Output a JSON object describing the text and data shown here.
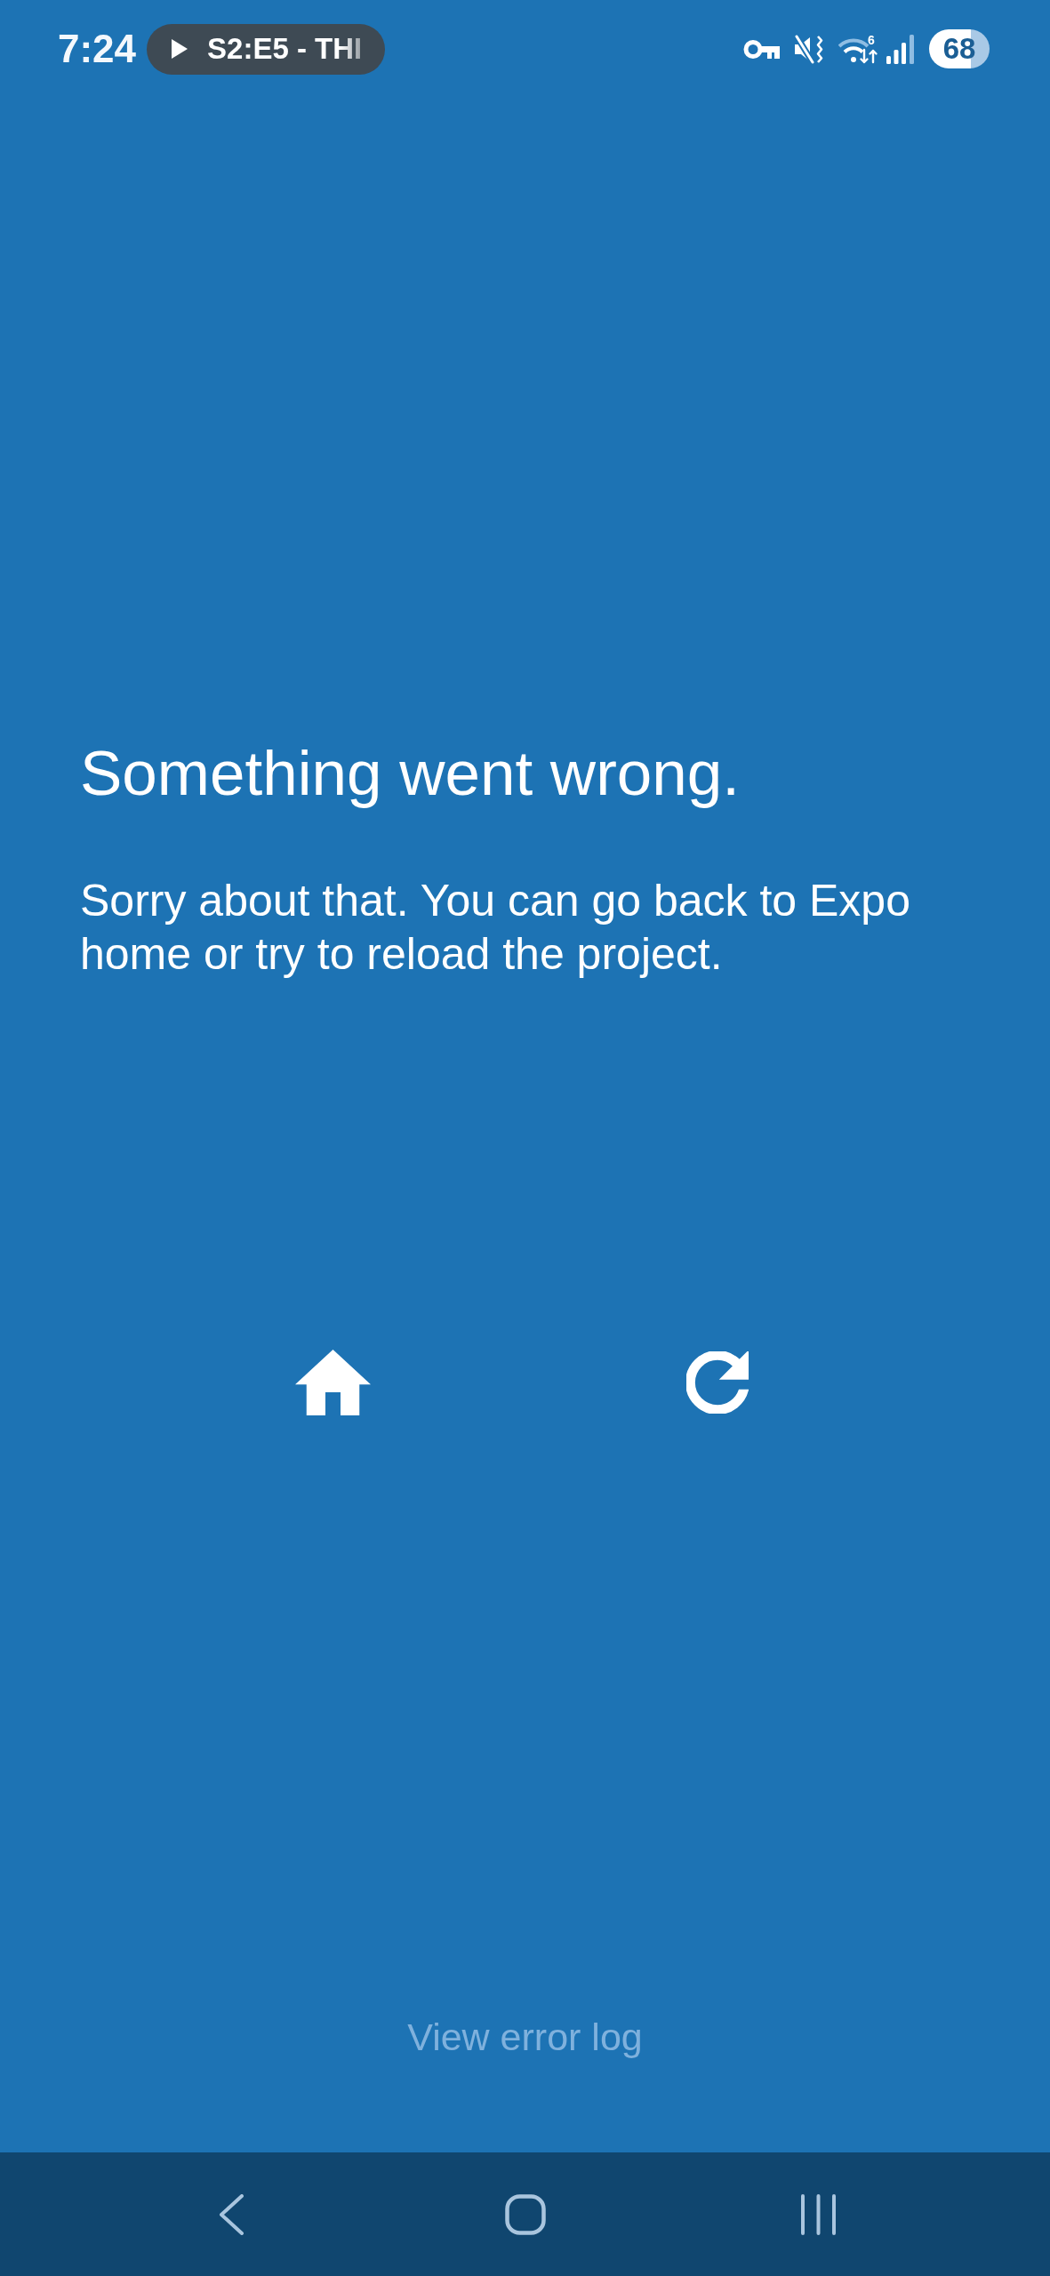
{
  "status_bar": {
    "time": "7:24",
    "media_chip": {
      "title": "S2:E5 - THI"
    },
    "wifi_label": "6",
    "battery": "68"
  },
  "error_screen": {
    "title": "Something went wrong.",
    "message": "Sorry about that. You can go back to Expo home or try to reload the project.",
    "actions": [
      {
        "kind": "home"
      },
      {
        "kind": "reload"
      }
    ],
    "log_link": "View error log"
  },
  "nav_bar": {
    "buttons": [
      {
        "kind": "back"
      },
      {
        "kind": "home"
      },
      {
        "kind": "recents"
      }
    ]
  }
}
